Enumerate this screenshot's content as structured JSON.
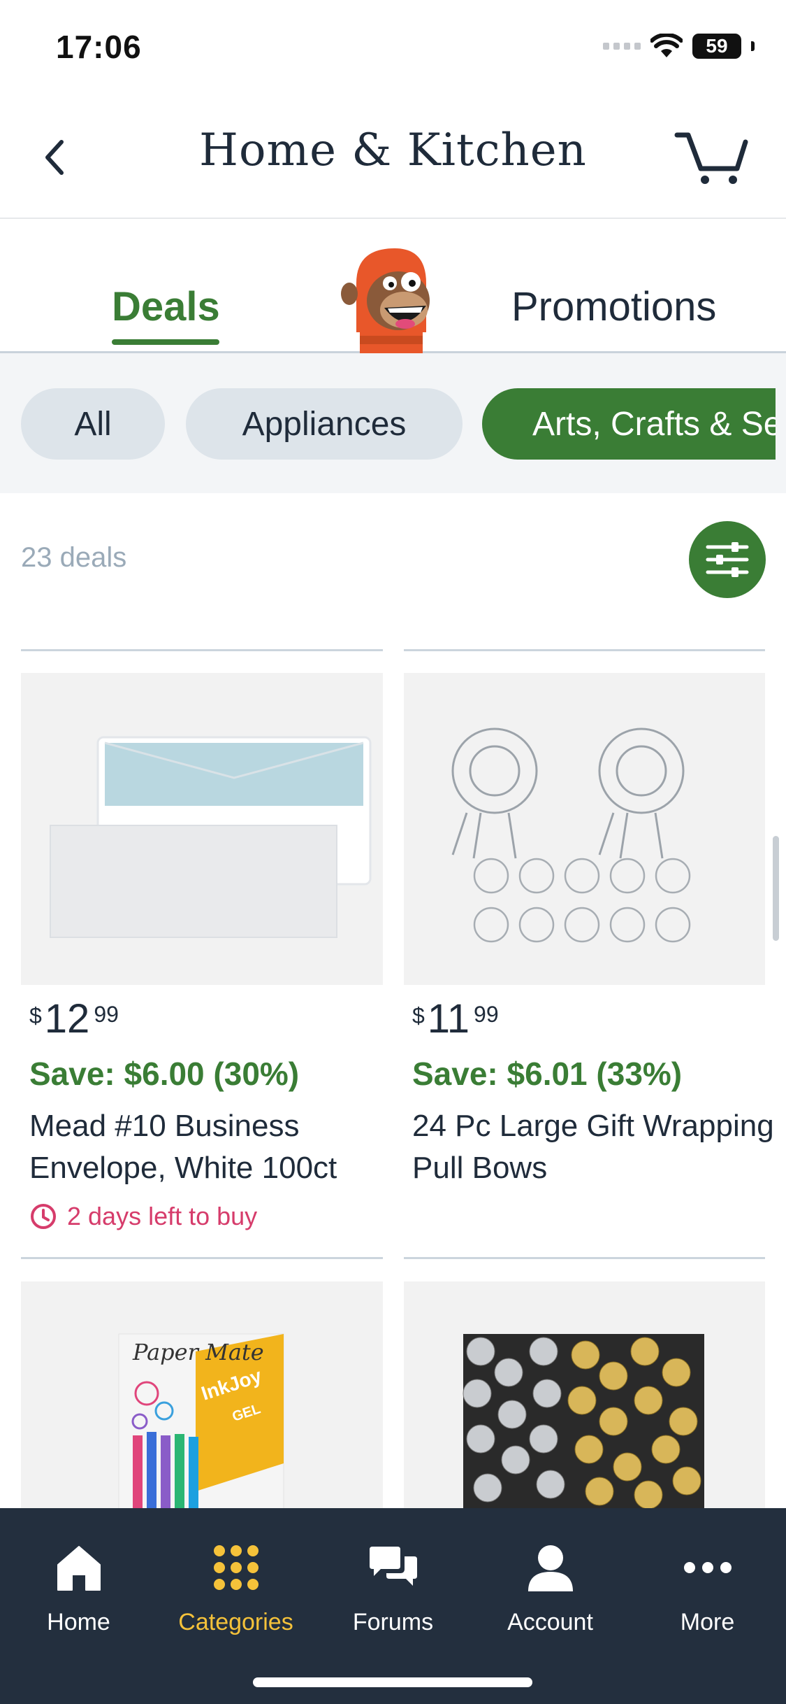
{
  "status_bar": {
    "time": "17:06",
    "battery": "59"
  },
  "header": {
    "title": "Home & Kitchen"
  },
  "tabs": [
    {
      "label": "Deals",
      "active": true
    },
    {
      "label": "Promotions",
      "active": false
    }
  ],
  "filters": [
    {
      "label": "All",
      "selected": false
    },
    {
      "label": "Appliances",
      "selected": false
    },
    {
      "label": "Arts, Crafts & Sewing",
      "selected": true
    }
  ],
  "deals_count": "23 deals",
  "products": [
    {
      "currency": "$",
      "price_whole": "12",
      "price_fraction": "99",
      "save": "Save: $6.00 (30%)",
      "title": "Mead #10 Business Envelope, White 100ct",
      "timer": "2 days left to buy"
    },
    {
      "currency": "$",
      "price_whole": "11",
      "price_fraction": "99",
      "save": "Save: $6.01 (33%)",
      "title": "24 Pc Large Gift Wrapping Pull Bows",
      "timer": ""
    },
    {
      "image_text": "Paper Mate InkJoy GEL"
    },
    {
      "image_text": ""
    }
  ],
  "bottom_nav": [
    {
      "label": "Home",
      "icon": "home-icon",
      "active": false
    },
    {
      "label": "Categories",
      "icon": "grid-icon",
      "active": true
    },
    {
      "label": "Forums",
      "icon": "chat-icon",
      "active": false
    },
    {
      "label": "Account",
      "icon": "person-icon",
      "active": false
    },
    {
      "label": "More",
      "icon": "more-icon",
      "active": false
    }
  ],
  "colors": {
    "accent_green": "#3a7d35",
    "nav_bg": "#232f3e",
    "nav_active": "#f5c23a",
    "timer_red": "#d63c6b"
  }
}
